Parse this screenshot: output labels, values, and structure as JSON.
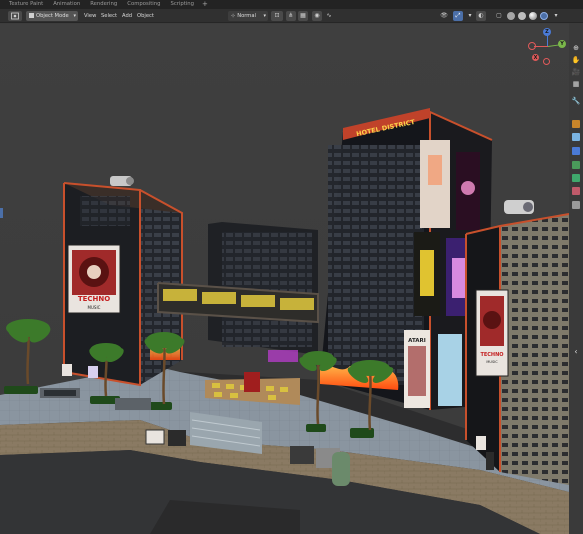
{
  "workspace_tabs": [
    "Texture Paint",
    "Animation",
    "Rendering",
    "Compositing",
    "Scripting",
    "+"
  ],
  "header": {
    "mode": "Object Mode",
    "menus": [
      "View",
      "Select",
      "Add",
      "Object"
    ],
    "orientation": "Normal"
  },
  "gizmo": {
    "axis_z": "Z",
    "axis_x": "X",
    "axis_y": "Y"
  },
  "scene": {
    "rooftop_sign": "HOTEL DISTRICT",
    "billboard_left_title": "TECHNO",
    "billboard_left_sub": "MUSIC",
    "billboard_right_title": "TECHNO",
    "billboard_right_sub": "MUSIC",
    "poster_atari": "ATARI"
  },
  "colors": {
    "accent": "#4b6fa8",
    "x_axis": "#e05a5a",
    "y_axis": "#7ab84a",
    "z_axis": "#4a7ad6",
    "neon_orange": "#ff8a2a"
  }
}
